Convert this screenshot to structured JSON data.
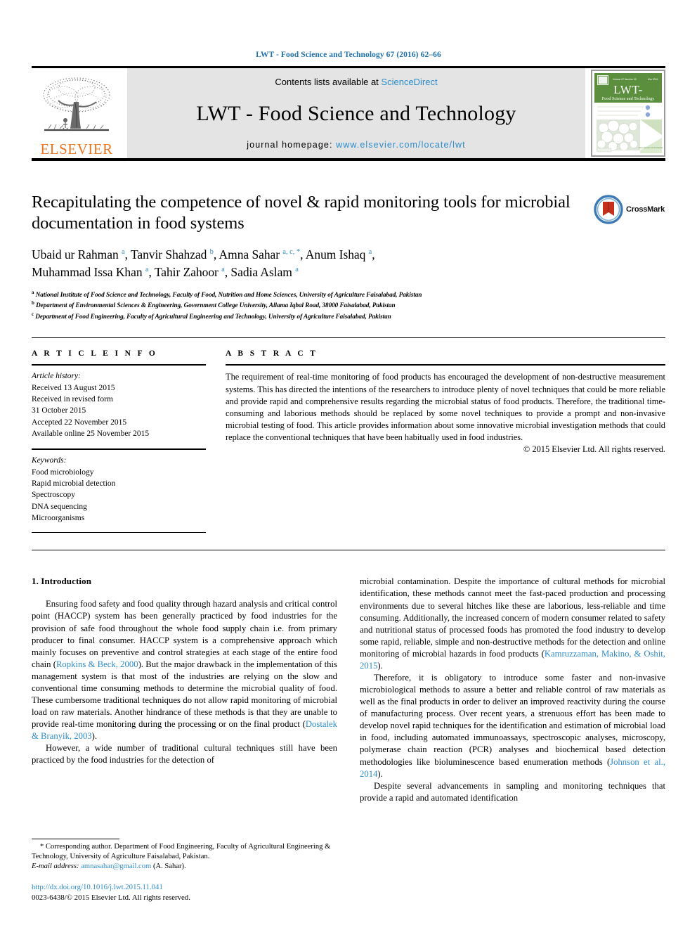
{
  "running_head": "LWT - Food Science and Technology 67 (2016) 62–66",
  "masthead": {
    "publisher_name": "ELSEVIER",
    "contents_prefix": "Contents lists available at",
    "contents_link": "ScienceDirect",
    "journal_title": "LWT - Food Science and Technology",
    "homepage_prefix": "journal homepage:",
    "homepage_url": "www.elsevier.com/locate/lwt",
    "cover": {
      "title_line1": "LWT-",
      "title_line2": "Food Science and Technology"
    }
  },
  "article": {
    "title": "Recapitulating the competence of novel & rapid monitoring tools for microbial documentation in food systems",
    "crossmark_label": "CrossMark",
    "authors_line1": "Ubaid ur Rahman <sup>a</sup>, Tanvir Shahzad <sup>b</sup>, Amna Sahar <sup>a, c, *</sup>, Anum Ishaq <sup>a</sup>,",
    "authors_line2": "Muhammad Issa Khan <sup>a</sup>, Tahir Zahoor <sup>a</sup>, Sadia Aslam <sup>a</sup>",
    "affiliations": [
      {
        "mark": "a",
        "text": "National Institute of Food Science and Technology, Faculty of Food, Nutrition and Home Sciences, University of Agriculture Faisalabad, Pakistan"
      },
      {
        "mark": "b",
        "text": "Department of Environmental Sciences & Engineering, Government College University, Allama Iqbal Road, 38000 Faisalabad, Pakistan"
      },
      {
        "mark": "c",
        "text": "Department of Food Engineering, Faculty of Agricultural Engineering and Technology, University of Agriculture Faisalabad, Pakistan"
      }
    ]
  },
  "article_info": {
    "heading": "A R T I C L E  I N F O",
    "history_label": "Article history:",
    "history": [
      "Received 13 August 2015",
      "Received in revised form",
      "31 October 2015",
      "Accepted 22 November 2015",
      "Available online 25 November 2015"
    ],
    "keywords_label": "Keywords:",
    "keywords": [
      "Food microbiology",
      "Rapid microbial detection",
      "Spectroscopy",
      "DNA sequencing",
      "Microorganisms"
    ]
  },
  "abstract": {
    "heading": "A B S T R A C T",
    "text": "The requirement of real-time monitoring of food products has encouraged the development of non-destructive measurement systems. This has directed the intentions of the researchers to introduce plenty of novel techniques that could be more reliable and provide rapid and comprehensive results regarding the microbial status of food products. Therefore, the traditional time-consuming and laborious methods should be replaced by some novel techniques to provide a prompt and non-invasive microbial testing of food. This article provides information about some innovative microbial investigation methods that could replace the conventional techniques that have been habitually used in food industries.",
    "copyright": "© 2015 Elsevier Ltd. All rights reserved."
  },
  "body": {
    "section_heading": "1. Introduction",
    "left_paragraphs": [
      {
        "pre": "Ensuring food safety and food quality through hazard analysis and critical control point (HACCP) system has been generally practiced by food industries for the provision of safe food throughout the whole food supply chain i.e. from primary producer to final consumer. HACCP system is a comprehensive approach which mainly focuses on preventive and control strategies at each stage of the entire food chain (",
        "cite": "Ropkins & Beck, 2000",
        "post": "). But the major drawback in the implementation of this management system is that most of the industries are relying on the slow and conventional time consuming methods to determine the microbial quality of food. These cumbersome traditional techniques do not allow rapid monitoring of microbial load on raw materials. Another hindrance of these methods is that they are unable to provide real-time monitoring during the processing or on the final product ("
      },
      {
        "pre": "",
        "cite": "Dostalek & Branyik, 2003",
        "post": ")."
      },
      {
        "pre": "However, a wide number of traditional cultural techniques still have been practiced by the food industries for the detection of",
        "cite": "",
        "post": ""
      }
    ],
    "right_paragraphs": [
      {
        "pre": "microbial contamination. Despite the importance of cultural methods for microbial identification, these methods cannot meet the fast-paced production and processing environments due to several hitches like these are laborious, less-reliable and time consuming. Additionally, the increased concern of modern consumer related to safety and nutritional status of processed foods has promoted the food industry to develop some rapid, reliable, simple and non-destructive methods for the detection and online monitoring of microbial hazards in food products (",
        "cite": "Kamruzzaman, Makino, & Oshit, 2015",
        "post": ")."
      },
      {
        "pre": "Therefore, it is obligatory to introduce some faster and non-invasive microbiological methods to assure a better and reliable control of raw materials as well as the final products in order to deliver an improved reactivity during the course of manufacturing process. Over recent years, a strenuous effort has been made to develop novel rapid techniques for the identification and estimation of microbial load in food, including automated immunoassays, spectroscopic analyses, microscopy, polymerase chain reaction (PCR) analyses and biochemical based detection methodologies like bioluminescence based enumeration methods (",
        "cite": "Johnson et al., 2014",
        "post": ")."
      },
      {
        "pre": "Despite several advancements in sampling and monitoring techniques that provide a rapid and automated identification",
        "cite": "",
        "post": ""
      }
    ]
  },
  "footnotes": {
    "corresponding": "* Corresponding author. Department of Food Engineering, Faculty of Agricultural Engineering & Technology, University of Agriculture Faisalabad, Pakistan.",
    "email_label": "E-mail address:",
    "email": "amnasahar@gmail.com",
    "email_suffix": "(A. Sahar).",
    "doi": "http://dx.doi.org/10.1016/j.lwt.2015.11.041",
    "issn_line": "0023-6438/© 2015 Elsevier Ltd. All rights reserved."
  },
  "colors": {
    "link": "#2e8bc9",
    "running_head": "#1f72ab",
    "elsevier_orange": "#e87722",
    "masthead_gray": "#e4e4e4",
    "cover_green": "#5b8f3e",
    "crossmark_blue": "#3d7ab5",
    "crossmark_red": "#c4301b"
  }
}
